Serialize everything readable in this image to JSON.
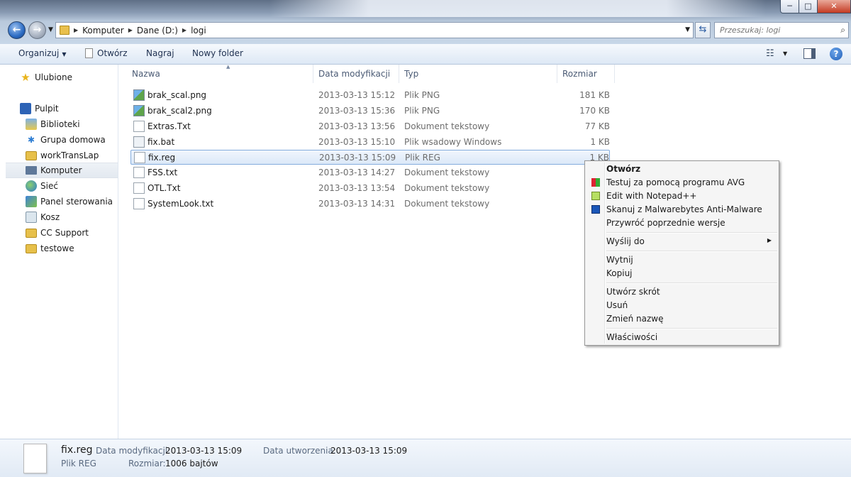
{
  "window": {
    "minimize_glyph": "─",
    "maximize_glyph": "□",
    "close_glyph": "✕"
  },
  "address": {
    "crumbs": [
      "Komputer",
      "Dane (D:)",
      "logi"
    ],
    "search_placeholder": "Przeszukaj: logi"
  },
  "toolbar": {
    "organize": "Organizuj",
    "open": "Otwórz",
    "burn": "Nagraj",
    "new_folder": "Nowy folder"
  },
  "sidebar": {
    "items": [
      {
        "label": "Ulubione",
        "icon": "star-icon"
      },
      {
        "label": "Pulpit",
        "icon": "desktop-icon"
      },
      {
        "label": "Biblioteki",
        "icon": "libraries-icon"
      },
      {
        "label": "Grupa domowa",
        "icon": "homegroup-icon"
      },
      {
        "label": "workTransLap",
        "icon": "user-folder-icon"
      },
      {
        "label": "Komputer",
        "icon": "computer-icon"
      },
      {
        "label": "Sieć",
        "icon": "network-icon"
      },
      {
        "label": "Panel sterowania",
        "icon": "control-panel-icon"
      },
      {
        "label": "Kosz",
        "icon": "recycle-bin-icon"
      },
      {
        "label": "CC Support",
        "icon": "folder-icon"
      },
      {
        "label": "testowe",
        "icon": "folder-icon"
      }
    ]
  },
  "columns": {
    "name": "Nazwa",
    "date": "Data modyfikacji",
    "type": "Typ",
    "size": "Rozmiar"
  },
  "files": [
    {
      "name": "brak_scal.png",
      "date": "2013-03-13 15:12",
      "type": "Plik PNG",
      "size": "181 KB",
      "icon": "png-file-icon"
    },
    {
      "name": "brak_scal2.png",
      "date": "2013-03-13 15:36",
      "type": "Plik PNG",
      "size": "170 KB",
      "icon": "png-file-icon"
    },
    {
      "name": "Extras.Txt",
      "date": "2013-03-13 13:56",
      "type": "Dokument tekstowy",
      "size": "77 KB",
      "icon": "text-file-icon"
    },
    {
      "name": "fix.bat",
      "date": "2013-03-13 15:10",
      "type": "Plik wsadowy Windows",
      "size": "1 KB",
      "icon": "batch-file-icon"
    },
    {
      "name": "fix.reg",
      "date": "2013-03-13 15:09",
      "type": "Plik REG",
      "size": "1 KB",
      "icon": "reg-file-icon"
    },
    {
      "name": "FSS.txt",
      "date": "2013-03-13 14:27",
      "type": "Dokument tekstowy",
      "size": "",
      "icon": "text-file-icon"
    },
    {
      "name": "OTL.Txt",
      "date": "2013-03-13 13:54",
      "type": "Dokument tekstowy",
      "size": "",
      "icon": "text-file-icon"
    },
    {
      "name": "SystemLook.txt",
      "date": "2013-03-13 14:31",
      "type": "Dokument tekstowy",
      "size": "",
      "icon": "text-file-icon"
    }
  ],
  "context_menu": {
    "open": "Otwórz",
    "avg": "Testuj za pomocą programu AVG",
    "notepad": "Edit with Notepad++",
    "malwarebytes": "Skanuj z Malwarebytes Anti-Malware",
    "restore": "Przywróć poprzednie wersje",
    "send_to": "Wyślij do",
    "cut": "Wytnij",
    "copy": "Kopiuj",
    "shortcut": "Utwórz skrót",
    "delete": "Usuń",
    "rename": "Zmień nazwę",
    "properties": "Właściwości"
  },
  "details": {
    "file_name": "fix.reg",
    "file_type": "Plik REG",
    "modified_label": "Data modyfikacji:",
    "modified_value": "2013-03-13 15:09",
    "created_label": "Data utworzenia:",
    "created_value": "2013-03-13 15:09",
    "size_label": "Rozmiar:",
    "size_value": "1006 bajtów"
  }
}
